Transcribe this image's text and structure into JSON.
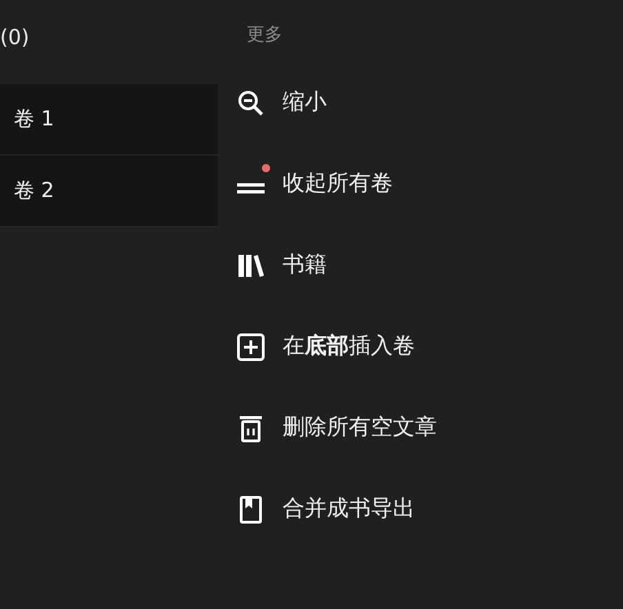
{
  "volume_panel": {
    "header": "(0)",
    "volumes": [
      {
        "label": "卷 1",
        "selected": false
      },
      {
        "label": "卷 2",
        "selected": false
      }
    ]
  },
  "more_menu": {
    "title": "更多",
    "items": [
      {
        "kind": "zoom-out",
        "label": "缩小",
        "dot": false
      },
      {
        "kind": "collapse",
        "label": "收起所有卷",
        "dot": true
      },
      {
        "kind": "books",
        "label": "书籍",
        "dot": false
      },
      {
        "kind": "insert",
        "label": "在**底部**插入卷",
        "dot": false
      },
      {
        "kind": "delete",
        "label": "删除所有空文章",
        "dot": false
      },
      {
        "kind": "export",
        "label": "合并成书导出",
        "dot": false
      }
    ]
  }
}
